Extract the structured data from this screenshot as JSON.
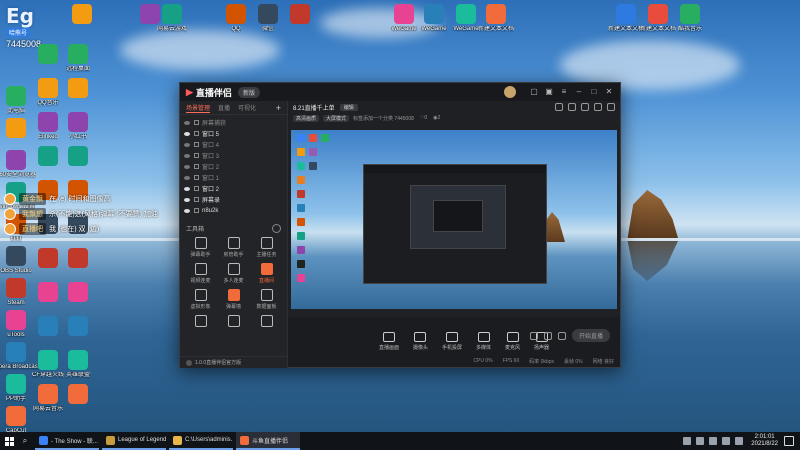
{
  "logo_overlay": {
    "brand": "Eg",
    "sub": "哈熊号",
    "id": "7445008"
  },
  "chat": [
    {
      "name": "黄金飘",
      "msg": "在 (e) 时间和图像高"
    },
    {
      "name": "我飘想",
      "msg": "杀(不能)选(风格)弹幕 (不要赞) 加油"
    },
    {
      "name": "直播吧",
      "msg": "我 (也在) 双 (边)"
    }
  ],
  "desktop_icons": {
    "c1": [
      "此电脑",
      "",
      "360安全浏览器",
      "Windows 设置",
      "钉钉",
      "OBS Studio",
      "Steam",
      "uTools",
      "Opera Broadcast...",
      "PP助手",
      "CapCut"
    ],
    "c2": [
      "",
      "QQ音乐",
      "Elinked",
      "",
      "",
      "",
      "",
      "",
      "",
      "CF穿越火线",
      "网易云音乐"
    ],
    "c3": [
      "远程桌面",
      "",
      "小红书",
      "",
      "",
      "",
      "",
      "",
      "",
      "英雄联盟",
      ""
    ],
    "top": [
      "",
      "",
      "网易云游戏",
      "QQ",
      "微信",
      "",
      "WeGame",
      "WeGame",
      "WeGame",
      "新建文本文档",
      "新建文本文档",
      "新建文本文档",
      "酷我音乐"
    ]
  },
  "app": {
    "brand": "直播伴侣",
    "version": "新版",
    "tabs": [
      "场景管理",
      "直播",
      "可视化"
    ],
    "scenes": [
      {
        "label": "屏幕捕获",
        "on": false
      },
      {
        "label": "窗口 5",
        "on": true
      },
      {
        "label": "窗口 4",
        "on": false
      },
      {
        "label": "窗口 3",
        "on": false
      },
      {
        "label": "窗口 2",
        "on": false
      },
      {
        "label": "窗口 1",
        "on": false
      },
      {
        "label": "窗口 2",
        "on": true
      },
      {
        "label": "屏幕录",
        "on": true
      },
      {
        "label": "n8u2k",
        "on": true
      }
    ],
    "tools_label": "工具箱",
    "tools": [
      "弹幕助手",
      "房管助手",
      "主播任务",
      "视频连麦",
      "多人连麦",
      "直播间",
      "虚拟形象",
      "弹幕墙",
      "数据面板",
      "",
      "",
      ""
    ],
    "footer": "1.0.0直播伴侣官方版",
    "stream_title": "8.21直播千上单",
    "edit_label": "编辑",
    "sub_chips": [
      "高清画质",
      "大屏模式"
    ],
    "sub_text": "标签添加一个分类  7445008",
    "sub_counts": [
      "0",
      "2"
    ],
    "controls": [
      "直播画面",
      "摄像头",
      "手机投屏",
      "多媒体",
      "麦克风",
      "扬声器"
    ],
    "live_button": "开始直播",
    "status": [
      "CPU 0%",
      "FPS 60",
      "码率 0kbps",
      "丢帧 0%",
      "网络 良好"
    ]
  },
  "taskbar": {
    "apps": [
      {
        "label": "- The Show - 联...",
        "color": "#3b82f6"
      },
      {
        "label": "League of Legends",
        "color": "#c89b3c"
      },
      {
        "label": "C:\\Users\\adminis...",
        "color": "#e8b64a"
      },
      {
        "label": "斗鱼直播伴侣",
        "color": "#f26b3a"
      }
    ],
    "time": "2:01:01",
    "date": "2021/8/22"
  },
  "colors": {
    "accent": "#f26b3a",
    "taskbar": "#101317",
    "app_bg": "#1f2024"
  }
}
